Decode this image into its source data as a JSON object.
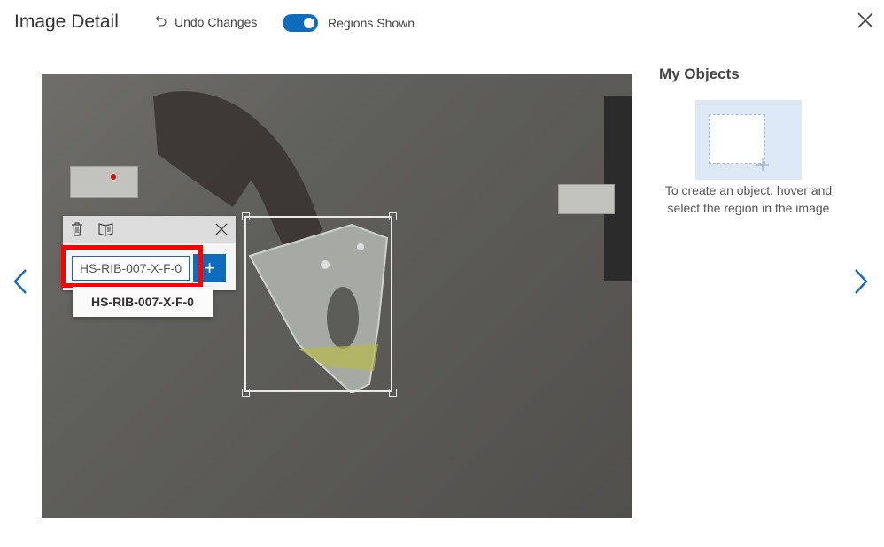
{
  "header": {
    "title": "Image Detail",
    "undo_label": "Undo Changes",
    "toggle_label": "Regions Shown",
    "toggle_on": true
  },
  "tag_editor": {
    "input_value": "HS-RIB-007-X-F-0",
    "suggestion": "HS-RIB-007-X-F-0",
    "add_symbol": "+"
  },
  "objects_panel": {
    "title": "My Objects",
    "help_text": "To create an object, hover and select the region in the image"
  },
  "colors": {
    "accent": "#0f6cbd",
    "highlight": "#ff0000"
  },
  "icons": [
    "undo-icon",
    "close-icon",
    "trash-icon",
    "split-icon",
    "chevron-left-icon",
    "chevron-right-icon",
    "plus-icon"
  ]
}
